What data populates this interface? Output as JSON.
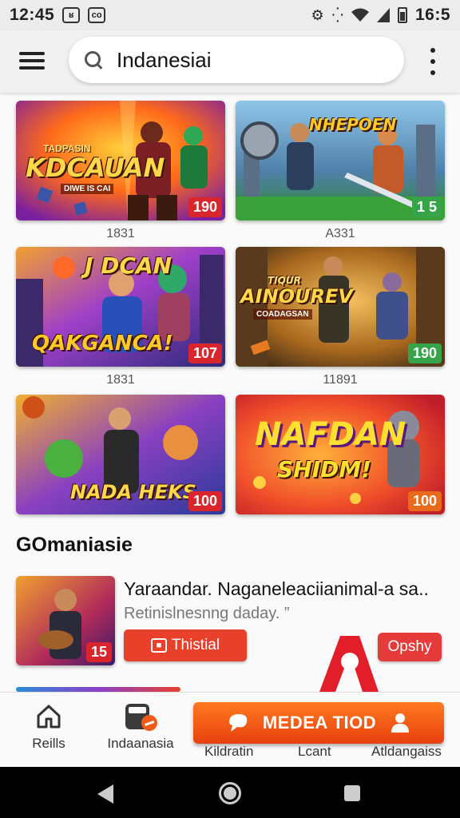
{
  "status_bar": {
    "time": "12:45",
    "box1": "ʁ",
    "box2": "co",
    "right_time": "16:5",
    "icons": [
      "settings-icon",
      "dots-icon",
      "wifi-icon",
      "signal-icon",
      "battery-icon"
    ]
  },
  "search": {
    "value": "Indanesiai"
  },
  "games": [
    {
      "title": "KDCAUAN",
      "subtitle": "TADPASIN",
      "tag": "DIWE IS CAI",
      "badge": "190",
      "badge_color": "red",
      "caption": "1831"
    },
    {
      "title": "NHEPOEN",
      "subtitle": "",
      "tag": "",
      "badge": "1 5",
      "badge_color": "green",
      "caption": "A331"
    },
    {
      "title": "J DCAN",
      "subtitle": "QAKGANCA!",
      "tag": "",
      "badge": "107",
      "badge_color": "red",
      "caption": "1831"
    },
    {
      "title": "AINOUREV",
      "subtitle": "TIQUR",
      "tag": "COADAGSAN",
      "badge": "190",
      "badge_color": "green",
      "caption": "11891"
    },
    {
      "title": "NADA HEKS",
      "subtitle": "",
      "tag": "",
      "badge": "100",
      "badge_color": "red",
      "caption": ""
    },
    {
      "title": "NAFDAN",
      "subtitle": "SHIDM!",
      "tag": "",
      "badge": "100",
      "badge_color": "orange",
      "caption": ""
    }
  ],
  "section": {
    "title": "GOmaniasie",
    "featured": {
      "title": "Yaraandar. Naganeleaciianimal-a sa..",
      "subtitle": "Retinislnesnng daday. ”",
      "badge": "15",
      "install_label": "Thistial",
      "open_label": "Opshy"
    }
  },
  "bottom_nav": {
    "items": [
      {
        "label": "Reills",
        "icon": "home-icon"
      },
      {
        "label": "Indaanasia",
        "icon": "store-icon"
      },
      {
        "label": "Kildratin"
      },
      {
        "label": "Lcant"
      },
      {
        "label": "Atldangaiss"
      }
    ],
    "cta_label": "MEDEA TIOD"
  },
  "colors": {
    "accent": "#e8402a",
    "green": "#36a448",
    "red": "#d8262c",
    "orange": "#ea6a1b"
  }
}
